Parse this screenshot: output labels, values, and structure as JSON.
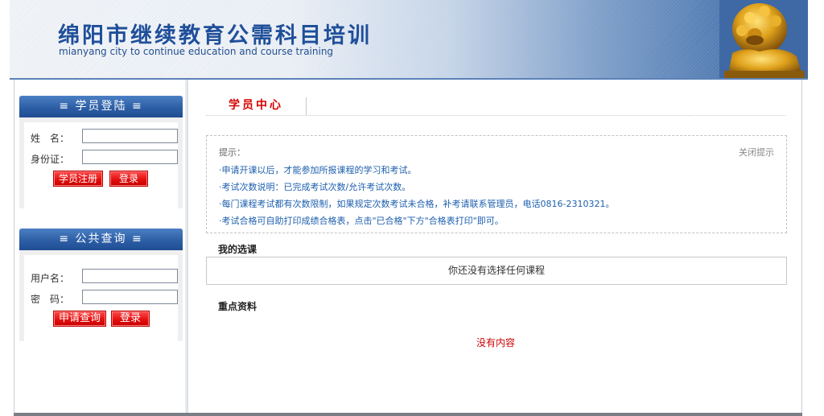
{
  "header": {
    "title": "绵阳市继续教育公需科目培训",
    "subtitle": "mianyang city to continue education and course training"
  },
  "login_panel": {
    "title": "≡ 学员登陆 ≡",
    "name_label": "姓　名：",
    "id_label": "身份证：",
    "register_button": "学员注册",
    "login_button": "登录"
  },
  "query_panel": {
    "title": "≡ 公共查询 ≡",
    "username_label": "用户名：",
    "password_label": "密　码：",
    "apply_button": "申请查询",
    "login_button": "登录"
  },
  "main": {
    "tab_label": "学员中心",
    "tips": {
      "heading": "提示：",
      "close_label": "关闭提示",
      "items": [
        "·申请开课以后，才能参加所报课程的学习和考试。",
        "·考试次数说明：已完成考试次数/允许考试次数。",
        "·每门课程考试都有次数限制，如果规定次数考试未合格，补考请联系管理员，电话0816-2310321。",
        "·考试合格可自助打印成绩合格表，点击\"已合格\"下方\"合格表打印\"即可。"
      ]
    },
    "my_courses_title": "我的选课",
    "no_course_text": "你还没有选择任何课程",
    "key_materials_title": "重点资料",
    "no_content_text": "没有内容"
  },
  "colors": {
    "brand_blue": "#1f4f9a",
    "panel_header": "#2d5fa6",
    "button_red": "#e20d0d",
    "tab_red": "#d50000",
    "tip_blue": "#1d5fae"
  }
}
